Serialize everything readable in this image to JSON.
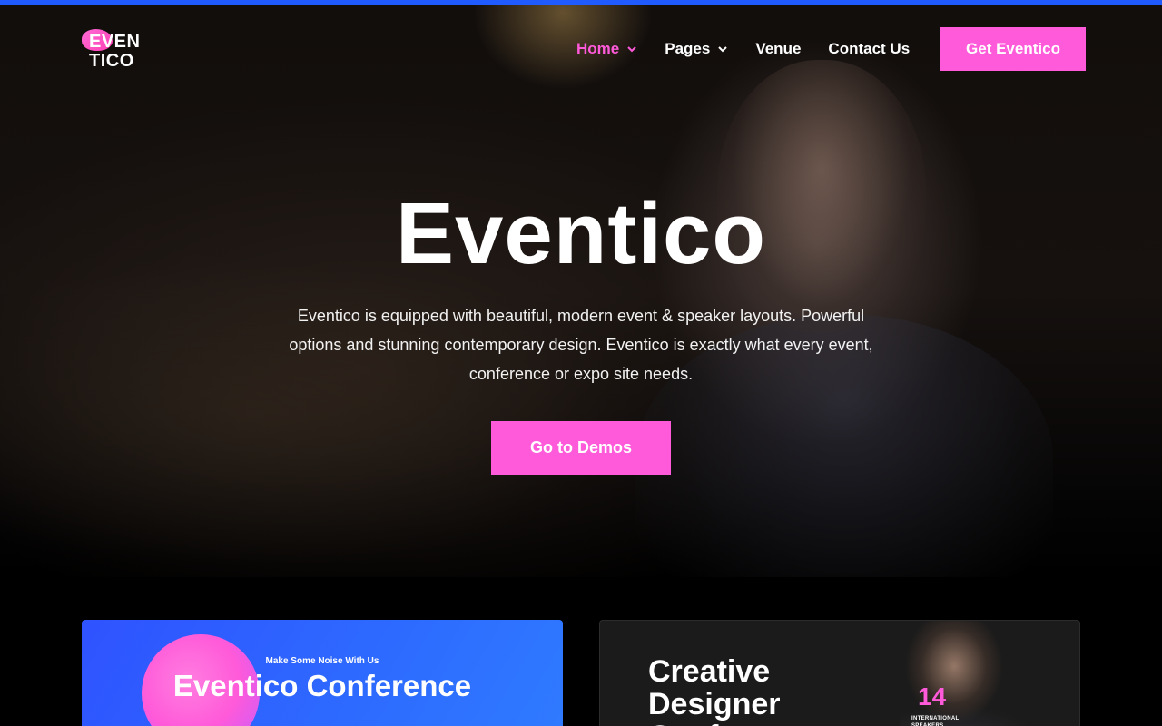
{
  "brand": {
    "logo_line1": "EVEN",
    "logo_line2": "TICO",
    "accent_color": "#ff5ad9",
    "top_bar_color": "#1f5bff"
  },
  "nav": {
    "items": [
      {
        "label": "Home",
        "has_dropdown": true,
        "active": true
      },
      {
        "label": "Pages",
        "has_dropdown": true,
        "active": false
      },
      {
        "label": "Venue",
        "has_dropdown": false,
        "active": false
      },
      {
        "label": "Contact Us",
        "has_dropdown": false,
        "active": false
      }
    ],
    "cta_label": "Get Eventico"
  },
  "hero": {
    "title": "Eventico",
    "description": "Eventico is equipped with beautiful, modern event & speaker layouts. Powerful options and stunning contemporary design. Eventico is exactly what every event, conference or expo site needs.",
    "button_label": "Go to Demos"
  },
  "demos": [
    {
      "tagline": "Make Some Noise With Us",
      "title": "Eventico Conference"
    },
    {
      "title": "Creative Designer Conference",
      "stat_number": "14",
      "stat_label": "International Speakers"
    }
  ]
}
